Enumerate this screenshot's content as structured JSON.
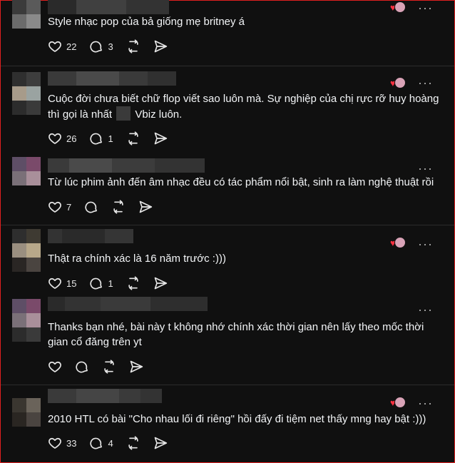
{
  "comments": [
    {
      "text": "Style nhạc pop của bả giống mẹ britney á",
      "likes": "22",
      "replies": "3",
      "has_reacts": true
    },
    {
      "text_a": "Cuộc đời chưa biết chữ flop viết sao luôn mà. Sự nghiệp của chị rực rỡ huy hoàng",
      "text_b_pre": "thì gọi là nhất",
      "text_b_post": "Vbiz luôn.",
      "likes": "26",
      "replies": "1",
      "has_reacts": true
    },
    {
      "text": "Từ lúc phim ảnh đến âm nhạc đều có tác phẩm nổi bật, sinh ra làm nghệ thuật rồi",
      "likes": "7",
      "replies": "",
      "has_reacts": false
    },
    {
      "text": "Thật ra chính xác là 16 năm trước :)))",
      "likes": "15",
      "replies": "1",
      "has_reacts": true
    },
    {
      "text_a": "Thanks bạn nhé, bài này t không nhớ chính xác thời gian nên lấy theo mốc thời",
      "text_b": "gian cổ đăng trên yt",
      "likes": "",
      "replies": "",
      "has_reacts": false
    },
    {
      "text": "2010 HTL có bài \"Cho nhau lối đi riêng\" hồi đấy đi tiệm net thấy mng hay bật :)))",
      "likes": "33",
      "replies": "4",
      "has_reacts": true
    }
  ],
  "icons": {
    "like": "heart-outline-icon",
    "reply": "comment-bubble-icon",
    "repost": "repost-icon",
    "share": "send-icon",
    "more": "more-dots-icon"
  },
  "colors": {
    "background": "#101010",
    "text": "#f3f5f7",
    "react_heart": "#ff3040",
    "frame": "#e0201f"
  }
}
